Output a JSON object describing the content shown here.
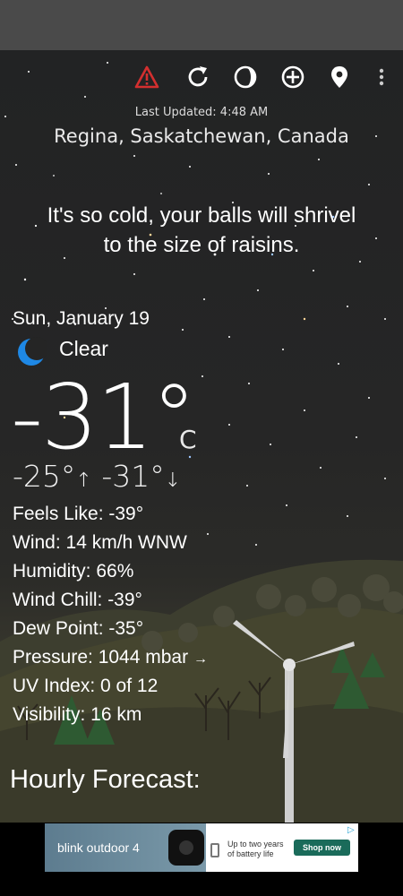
{
  "header": {
    "last_updated": "Last Updated: 4:48 AM",
    "location": "Regina, Saskatchewan, Canada"
  },
  "toolbar": {
    "icons": [
      "alert-icon",
      "refresh-icon",
      "moon-phase-icon",
      "add-location-icon",
      "location-pin-icon",
      "more-icon"
    ]
  },
  "quip": {
    "line1": "It's so cold, your balls will shrivel",
    "line2": "to the size of raisins."
  },
  "current": {
    "date": "Sun, January 19",
    "condition": "Clear",
    "condition_icon": "crescent-moon-icon",
    "temperature": "-31°",
    "unit": "C",
    "high": "-25°",
    "high_arrow": "↑",
    "low": "-31°",
    "low_arrow": "↓"
  },
  "details": {
    "feels_like": "Feels Like:  -39°",
    "wind": "Wind:  14 km/h WNW",
    "humidity": "Humidity:  66%",
    "wind_chill": "Wind Chill:  -39°",
    "dew_point": "Dew Point:  -35°",
    "pressure": "Pressure:  1044 mbar",
    "pressure_trend": "→",
    "uv_index": "UV Index:  0 of 12",
    "visibility": "Visibility:  16 km"
  },
  "hourly": {
    "title": "Hourly Forecast:"
  },
  "ad": {
    "brand": "blink outdoor 4",
    "copy_line1": "Up to two years",
    "copy_line2": "of battery life",
    "cta": "Shop now",
    "choices_icon": "ad-choices-icon"
  },
  "colors": {
    "alert": "#d32f2f",
    "moon": "#1e88e5",
    "cta": "#1a6b5a"
  }
}
